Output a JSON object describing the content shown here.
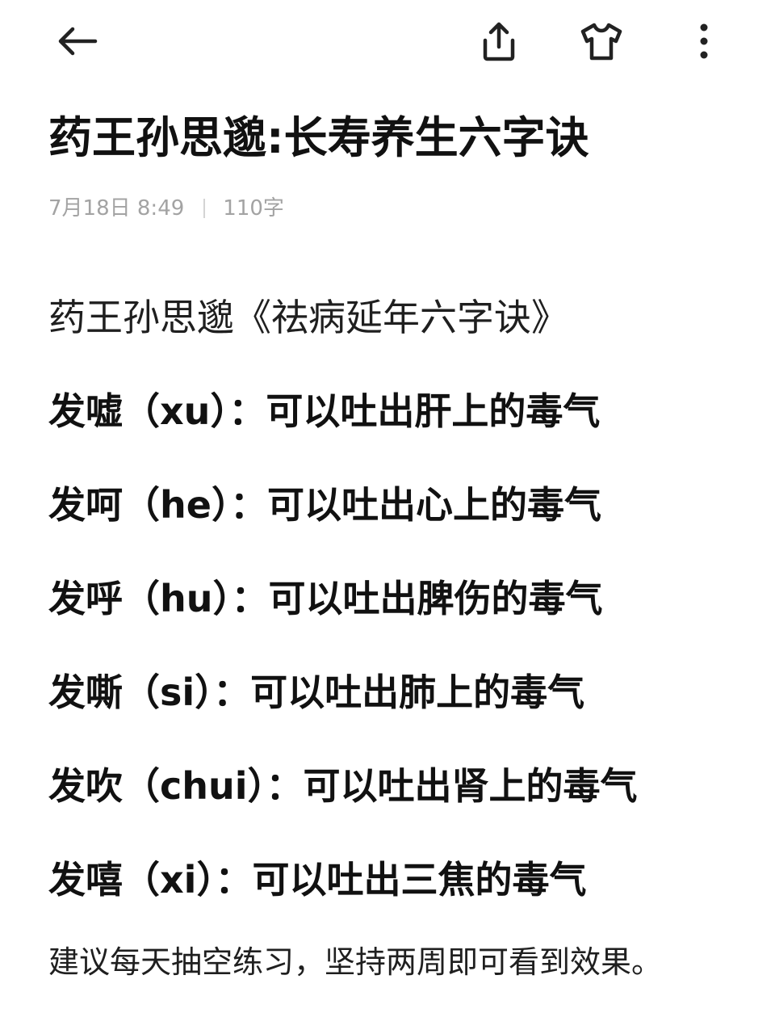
{
  "toolbar": {
    "back_icon": "arrow-left-icon",
    "share_icon": "share-icon",
    "theme_icon": "tshirt-icon",
    "more_icon": "more-vertical-icon"
  },
  "note": {
    "title": "药王孙思邈:长寿养生六字诀",
    "date": "7月18日 8:49",
    "word_count": "110字"
  },
  "body": {
    "intro": "药王孙思邈《祛病延年六字诀》",
    "lines": [
      "发嘘（xu）：可以吐出肝上的毒气",
      "发呵（he）：可以吐出心上的毒气",
      "发呼（hu）：可以吐出脾伤的毒气",
      "发嘶（si）：可以吐出肺上的毒气",
      "发吹（chui）：可以吐出肾上的毒气",
      "发嘻（xi）：可以吐出三焦的毒气"
    ],
    "footer": "建议每天抽空练习，坚持两周即可看到效果。"
  }
}
